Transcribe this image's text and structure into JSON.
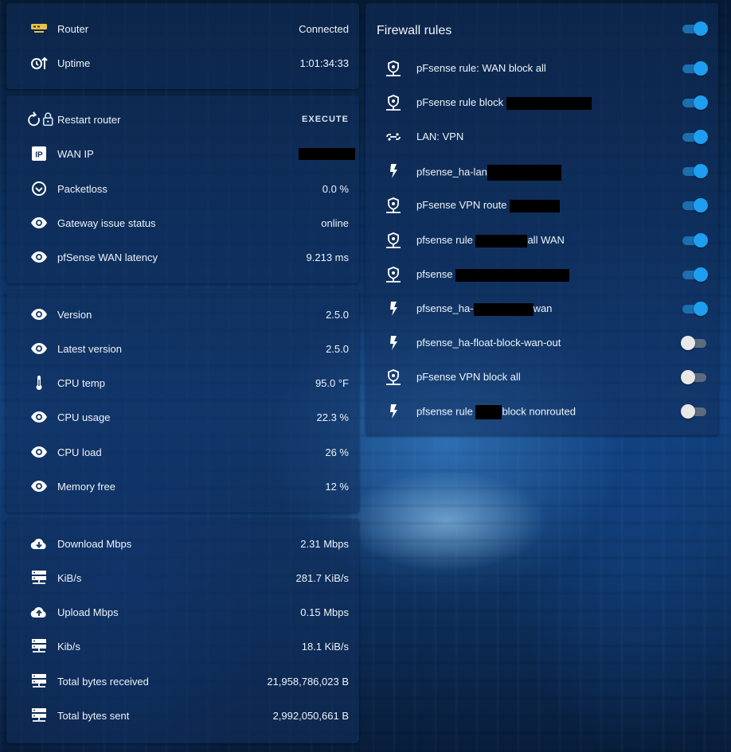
{
  "router_card": {
    "rows": [
      {
        "icon": "router-icon",
        "label": "Router",
        "value": "Connected"
      },
      {
        "icon": "uptime-icon",
        "label": "Uptime",
        "value": "1:01:34:33"
      }
    ]
  },
  "wan_card": {
    "restart": {
      "label": "Restart router",
      "action": "EXECUTE"
    },
    "rows": [
      {
        "icon": "ip-icon",
        "label": "WAN IP",
        "value": ""
      },
      {
        "icon": "check-circle-icon",
        "label": "Packetloss",
        "value": "0.0 %"
      },
      {
        "icon": "eye-icon",
        "label": "Gateway issue status",
        "value": "online"
      },
      {
        "icon": "eye-icon",
        "label": "pfSense WAN latency",
        "value": "9.213 ms"
      }
    ]
  },
  "system_card": {
    "rows": [
      {
        "icon": "eye-icon",
        "label": "Version",
        "value": "2.5.0"
      },
      {
        "icon": "eye-icon",
        "label": "Latest version",
        "value": "2.5.0"
      },
      {
        "icon": "thermometer-icon",
        "label": "CPU temp",
        "value": "95.0 °F"
      },
      {
        "icon": "eye-icon",
        "label": "CPU usage",
        "value": "22.3 %"
      },
      {
        "icon": "eye-icon",
        "label": "CPU load",
        "value": "26 %"
      },
      {
        "icon": "eye-icon",
        "label": "Memory free",
        "value": "12 %"
      }
    ]
  },
  "traffic_card": {
    "rows": [
      {
        "icon": "cloud-download-icon",
        "label": "Download Mbps",
        "value": "2.31 Mbps"
      },
      {
        "icon": "server-icon",
        "label": "KiB/s",
        "value": "281.7 KiB/s"
      },
      {
        "icon": "cloud-upload-icon",
        "label": "Upload Mbps",
        "value": "0.15 Mbps"
      },
      {
        "icon": "server-icon",
        "label": "Kib/s",
        "value": "18.1 KiB/s"
      },
      {
        "icon": "server-icon",
        "label": "Total bytes received",
        "value": "21,958,786,023 B"
      },
      {
        "icon": "server-icon",
        "label": "Total bytes sent",
        "value": "2,992,050,661 B"
      }
    ]
  },
  "firewall": {
    "title": "Firewall rules",
    "master_on": true,
    "rules": [
      {
        "icon": "shield-pin-icon",
        "label": "pFsense rule: WAN block all",
        "on": true
      },
      {
        "icon": "shield-pin-icon",
        "label": "pFsense rule block",
        "on": true
      },
      {
        "icon": "lan-link-icon",
        "label": "LAN: VPN",
        "on": true
      },
      {
        "icon": "flash-icon",
        "label": "pfsense_ha-lan",
        "on": true
      },
      {
        "icon": "shield-pin-icon",
        "label": "pFsense VPN route",
        "on": true
      },
      {
        "icon": "shield-pin-icon",
        "label": "pfsense rule",
        "label_after": "all WAN",
        "on": true
      },
      {
        "icon": "shield-pin-icon",
        "label": "pfsense",
        "on": true
      },
      {
        "icon": "flash-icon",
        "label": "pfsense_ha-",
        "label_after": "wan",
        "on": true
      },
      {
        "icon": "flash-icon",
        "label": "pfsense_ha-float-block-wan-out",
        "on": false
      },
      {
        "icon": "shield-pin-icon",
        "label": "pFsense VPN block all",
        "on": false
      },
      {
        "icon": "flash-icon",
        "label": "pfsense rule",
        "label_after": "block nonrouted",
        "on": false
      }
    ]
  }
}
